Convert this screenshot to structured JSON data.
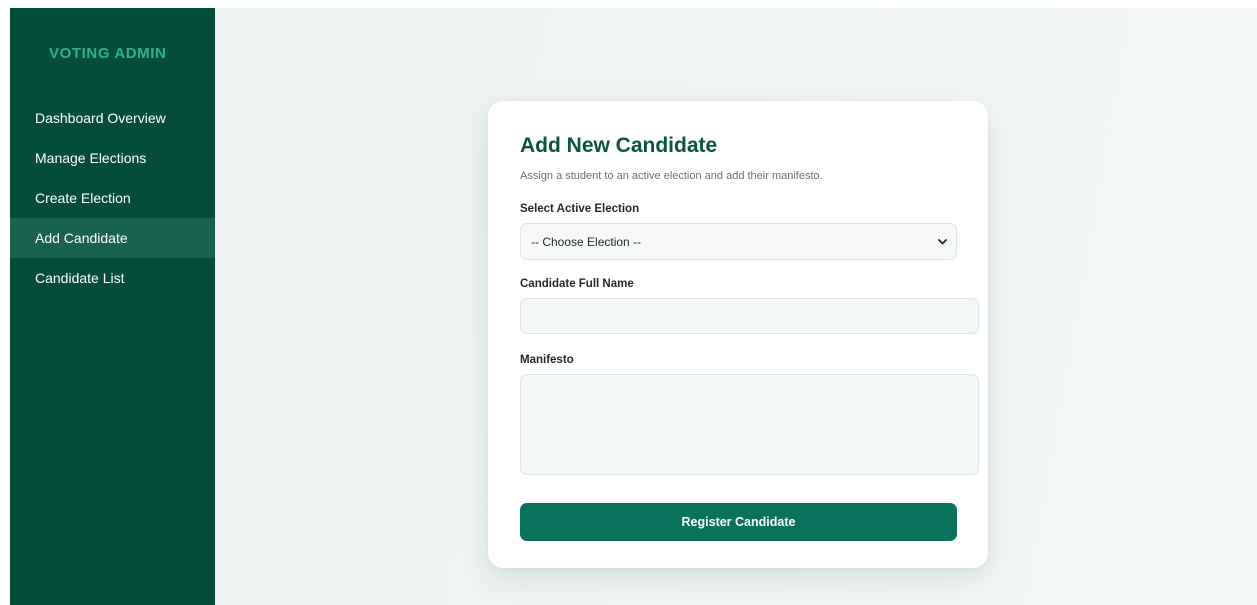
{
  "app": {
    "brand": "VOTING ADMIN"
  },
  "sidebar": {
    "items": [
      {
        "label": "Dashboard Overview",
        "active": false
      },
      {
        "label": "Manage Elections",
        "active": false
      },
      {
        "label": "Create Election",
        "active": false
      },
      {
        "label": "Add Candidate",
        "active": true
      },
      {
        "label": "Candidate List",
        "active": false
      }
    ]
  },
  "form": {
    "title": "Add New Candidate",
    "subtitle": "Assign a student to an active election and add their manifesto.",
    "election_label": "Select Active Election",
    "election_selected": "-- Choose Election --",
    "name_label": "Candidate Full Name",
    "name_value": "",
    "manifesto_label": "Manifesto",
    "manifesto_value": "",
    "submit_label": "Register Candidate"
  },
  "icons": {
    "select_indicator": "chevron-down-icon"
  },
  "colors": {
    "sidebar_bg": "#044d3b",
    "sidebar_active_bg": "#19624f",
    "brand_text": "#2bb38c",
    "title_text": "#0a5541",
    "primary_button": "#09725c",
    "page_bg": "#eaf1ee"
  }
}
